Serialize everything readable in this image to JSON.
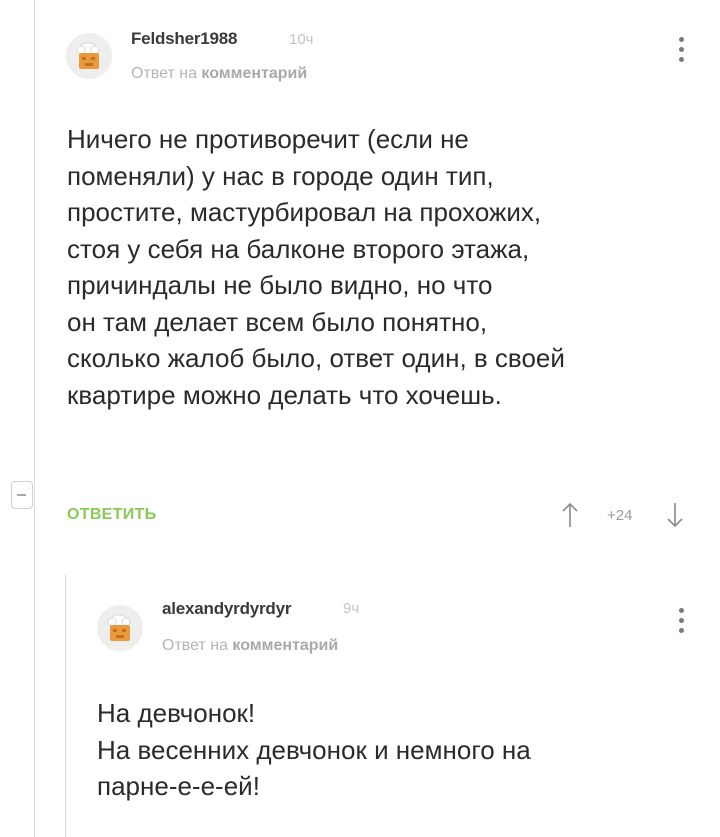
{
  "comment": {
    "author": "Feldsher1988",
    "time": "10ч",
    "reply_prefix": "Ответ на",
    "reply_link": "комментарий",
    "text_lines": [
      "Ничего не противоречит (если не",
      "поменяли) у нас в городе один тип,",
      "простите, мастурбировал на прохожих,",
      "стоя у себя на балконе второго этажа,",
      "причиндалы не было видно, но что",
      "он там делает всем было понятно,",
      "сколько жалоб было, ответ один, в своей",
      "квартире можно делать что хочешь."
    ],
    "reply_button": "ОТВЕТИТЬ",
    "rating": "+24"
  },
  "reply": {
    "author": "alexandyrdyrdyr",
    "time": "9ч",
    "reply_prefix": "Ответ на",
    "reply_link": "комментарий",
    "text_lines": [
      "На девчонок!",
      "На весенних девчонок и немного на",
      "парне-е-е-ей!"
    ]
  },
  "icons": {
    "avatar": "chef-hat-avatar-icon",
    "menu": "kebab-menu-icon",
    "upvote": "arrow-up-icon",
    "downvote": "arrow-down-icon",
    "collapse": "minus-icon"
  },
  "colors": {
    "accent_green": "#8ac858",
    "avatar_orange": "#e89a3c",
    "thread_line": "#d9d9d9"
  }
}
